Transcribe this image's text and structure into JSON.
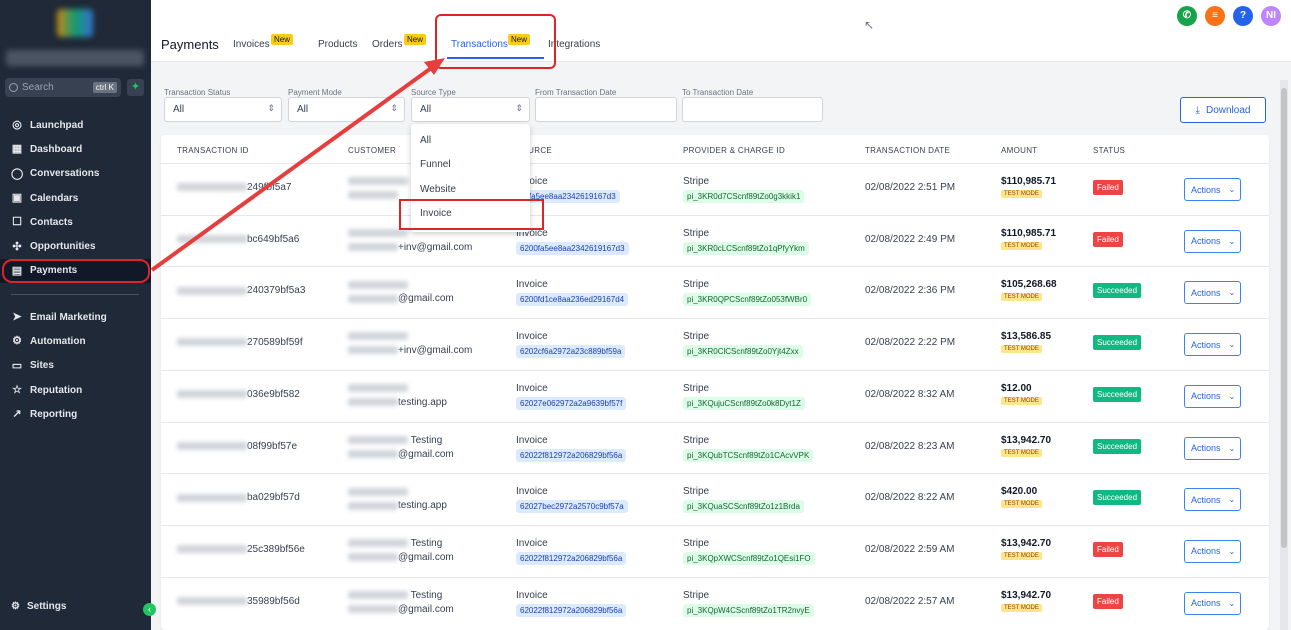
{
  "sidebar": {
    "search": {
      "placeholder": "Search",
      "shortcut": "ctrl K"
    },
    "items": [
      {
        "label": "Launchpad",
        "icon": "launchpad-icon"
      },
      {
        "label": "Dashboard",
        "icon": "dashboard-icon"
      },
      {
        "label": "Conversations",
        "icon": "chat-icon"
      },
      {
        "label": "Calendars",
        "icon": "calendar-icon"
      },
      {
        "label": "Contacts",
        "icon": "contacts-icon"
      },
      {
        "label": "Opportunities",
        "icon": "opportunities-icon"
      },
      {
        "label": "Payments",
        "icon": "payments-icon",
        "active": true
      }
    ],
    "items2": [
      {
        "label": "Email Marketing",
        "icon": "send-icon"
      },
      {
        "label": "Automation",
        "icon": "automation-icon"
      },
      {
        "label": "Sites",
        "icon": "sites-icon"
      },
      {
        "label": "Reputation",
        "icon": "star-icon"
      },
      {
        "label": "Reporting",
        "icon": "chart-icon"
      }
    ],
    "settings": "Settings"
  },
  "header": {
    "title": "Payments",
    "tabs": [
      {
        "label": "Invoices",
        "badge": "New"
      },
      {
        "label": "Products",
        "badge": ""
      },
      {
        "label": "Orders",
        "badge": "New"
      },
      {
        "label": "Transactions",
        "badge": "New",
        "active": true
      },
      {
        "label": "Integrations",
        "badge": ""
      }
    ],
    "avatar": "NI"
  },
  "filters": {
    "status": {
      "label": "Transaction Status",
      "value": "All"
    },
    "mode": {
      "label": "Payment Mode",
      "value": "All"
    },
    "source": {
      "label": "Source Type",
      "value": "All"
    },
    "from": {
      "label": "From Transaction Date",
      "value": ""
    },
    "to": {
      "label": "To Transaction Date",
      "value": ""
    },
    "download": "Download"
  },
  "dropdown": {
    "options": [
      "All",
      "Funnel",
      "Website",
      "Invoice"
    ]
  },
  "table": {
    "headers": [
      "TRANSACTION ID",
      "CUSTOMER",
      "SOURCE",
      "PROVIDER & CHARGE ID",
      "TRANSACTION DATE",
      "AMOUNT",
      "STATUS"
    ],
    "rows": [
      {
        "tid": "249fbf5a7",
        "cust": "",
        "source": "Invoice",
        "sid": "00fa5ee8aa2342619167d3",
        "provider": "Stripe",
        "charge": "pi_3KR0d7CScnf89tZo0g3kkik1",
        "date": "02/08/2022 2:51 PM",
        "amount": "$110,985.71",
        "mode": "TEST MODE",
        "status": "Failed"
      },
      {
        "tid": "bc649bf5a6",
        "cust": "+inv@gmail.com",
        "source": "Invoice",
        "sid": "6200fa5ee8aa2342619167d3",
        "provider": "Stripe",
        "charge": "pi_3KR0cLCScnf89tZo1qPfyYkm",
        "date": "02/08/2022 2:49 PM",
        "amount": "$110,985.71",
        "mode": "TEST MODE",
        "status": "Failed"
      },
      {
        "tid": "240379bf5a3",
        "cust": "@gmail.com",
        "source": "Invoice",
        "sid": "6200fd1ce8aa236ed29167d4",
        "provider": "Stripe",
        "charge": "pi_3KR0QPCScnf89tZo053fWBr0",
        "date": "02/08/2022 2:36 PM",
        "amount": "$105,268.68",
        "mode": "TEST MODE",
        "status": "Succeeded"
      },
      {
        "tid": "270589bf59f",
        "cust": "+inv@gmail.com",
        "source": "Invoice",
        "sid": "6202cf6a2972a23c889bf59a",
        "provider": "Stripe",
        "charge": "pi_3KR0ClCScnf89tZo0Yjt4Zxx",
        "date": "02/08/2022 2:22 PM",
        "amount": "$13,586.85",
        "mode": "TEST MODE",
        "status": "Succeeded"
      },
      {
        "tid": "036e9bf582",
        "cust": "testing.app",
        "source": "Invoice",
        "sid": "62027e062972a2a9639bf57f",
        "provider": "Stripe",
        "charge": "pi_3KQujuCScnf89tZo0k8Dyt1Z",
        "date": "02/08/2022 8:32 AM",
        "amount": "$12.00",
        "mode": "TEST MODE",
        "status": "Succeeded"
      },
      {
        "tid": "08f99bf57e",
        "cust": "@gmail.com",
        "cust2": "Testing",
        "source": "Invoice",
        "sid": "62022f812972a206829bf56a",
        "provider": "Stripe",
        "charge": "pi_3KQubTCScnf89tZo1CAcvVPK",
        "date": "02/08/2022 8:23 AM",
        "amount": "$13,942.70",
        "mode": "TEST MODE",
        "status": "Succeeded"
      },
      {
        "tid": "ba029bf57d",
        "cust": "testing.app",
        "source": "Invoice",
        "sid": "62027bec2972a2570c9bf57a",
        "provider": "Stripe",
        "charge": "pi_3KQuaSCScnf89tZo1z1Brda",
        "date": "02/08/2022 8:22 AM",
        "amount": "$420.00",
        "mode": "TEST MODE",
        "status": "Succeeded"
      },
      {
        "tid": "25c389bf56e",
        "cust": "@gmail.com",
        "cust2": "Testing",
        "source": "Invoice",
        "sid": "62022f812972a206829bf56a",
        "provider": "Stripe",
        "charge": "pi_3KQpXWCScnf89tZo1QEsi1FO",
        "date": "02/08/2022 2:59 AM",
        "amount": "$13,942.70",
        "mode": "TEST MODE",
        "status": "Failed"
      },
      {
        "tid": "35989bf56d",
        "cust": "@gmail.com",
        "cust2": "Testing",
        "source": "Invoice",
        "sid": "62022f812972a206829bf56a",
        "provider": "Stripe",
        "charge": "pi_3KQpW4CScnf89tZo1TR2nvyE",
        "date": "02/08/2022 2:57 AM",
        "amount": "$13,942.70",
        "mode": "TEST MODE",
        "status": "Failed"
      }
    ],
    "actions_label": "Actions"
  }
}
